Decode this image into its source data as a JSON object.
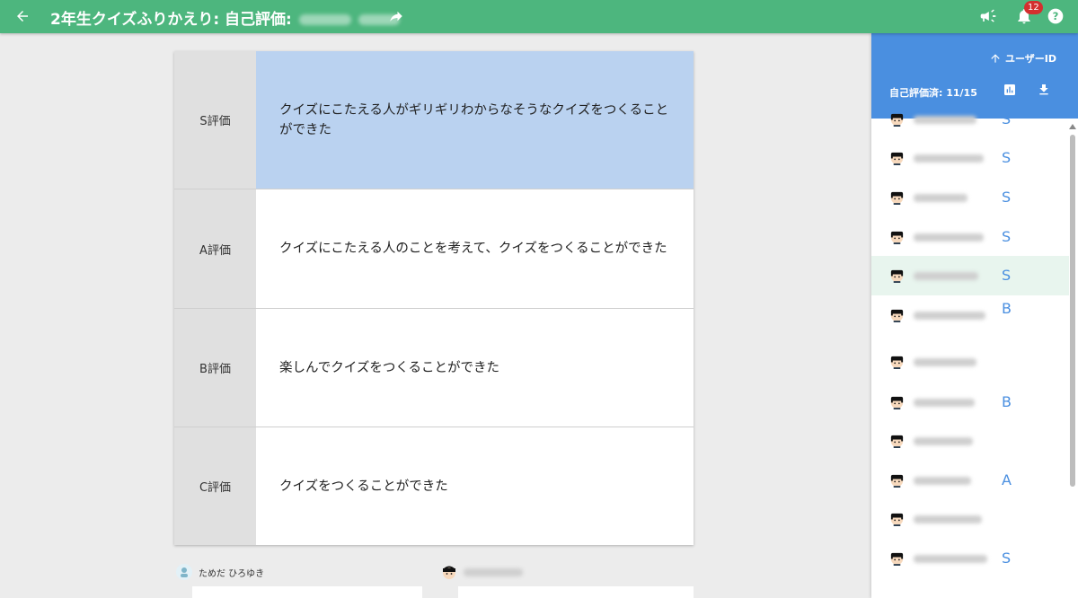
{
  "header": {
    "title": "2年生クイズふりかえり: 自己評価:",
    "notification_count": "12",
    "icons": [
      "back-arrow-icon",
      "share-arrow-icon",
      "megaphone-icon",
      "bell-icon",
      "help-icon"
    ],
    "color": "#4db67e"
  },
  "rubric": {
    "rows": [
      {
        "label": "S評価",
        "text": "クイズにこたえる人がギリギリわからなそうなクイズをつくることができた",
        "selected": true
      },
      {
        "label": "A評価",
        "text": "クイズにこたえる人のことを考えて、クイズをつくることができた",
        "selected": false
      },
      {
        "label": "B評価",
        "text": "楽しんでクイズをつくることができた",
        "selected": false
      },
      {
        "label": "C評価",
        "text": "クイズをつくることができた",
        "selected": false
      }
    ],
    "selected_color": "#bad2f0"
  },
  "comments": [
    {
      "author": "ためだ ひろゆき"
    }
  ],
  "panel": {
    "sort_label": "ユーザーID",
    "progress": "自己評価済: 11/15",
    "accent": "#4a8fe0",
    "grades": [
      "S",
      "S",
      "S",
      "S",
      "S",
      "B",
      "",
      "B",
      "",
      "A",
      "",
      "S"
    ]
  }
}
